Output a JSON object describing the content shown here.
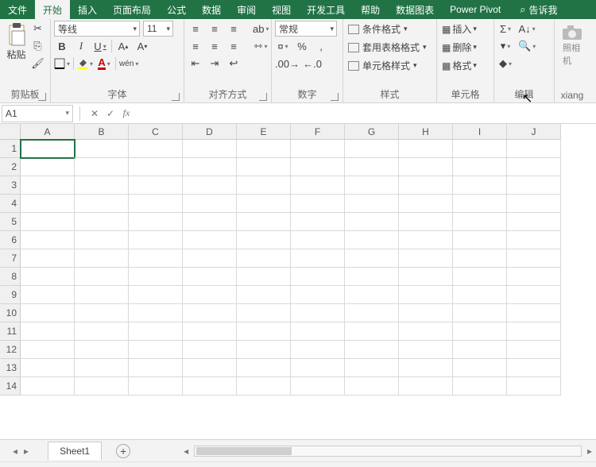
{
  "tabs": {
    "file": "文件",
    "home": "开始",
    "insert": "插入",
    "layout": "页面布局",
    "formulas": "公式",
    "data": "数据",
    "review": "审阅",
    "view": "视图",
    "developer": "开发工具",
    "help": "帮助",
    "datachart": "数据图表",
    "powerpivot": "Power Pivot",
    "tellme": "告诉我"
  },
  "groups": {
    "clipboard": {
      "label": "剪贴板",
      "paste": "粘贴"
    },
    "font": {
      "label": "字体",
      "family": "等线",
      "size": "11",
      "bold": "B",
      "italic": "I",
      "underline": "U",
      "wen": "wén"
    },
    "align": {
      "label": "对齐方式"
    },
    "number": {
      "label": "数字",
      "format": "常规",
      "percent": "%"
    },
    "styles": {
      "label": "样式",
      "cond": "条件格式",
      "table": "套用表格格式",
      "cells": "单元格样式"
    },
    "cells": {
      "label": "单元格",
      "insert": "插入",
      "delete": "删除",
      "format": "格式"
    },
    "edit": {
      "label": "编辑",
      "sigma": "Σ"
    },
    "camera": {
      "label": "xiang",
      "cap": "照相机"
    }
  },
  "formula_bar": {
    "name_box": "A1",
    "fx": "fx"
  },
  "sheet": {
    "cols": [
      "A",
      "B",
      "C",
      "D",
      "E",
      "F",
      "G",
      "H",
      "I",
      "J"
    ],
    "rows": 14,
    "tab": "Sheet1"
  }
}
